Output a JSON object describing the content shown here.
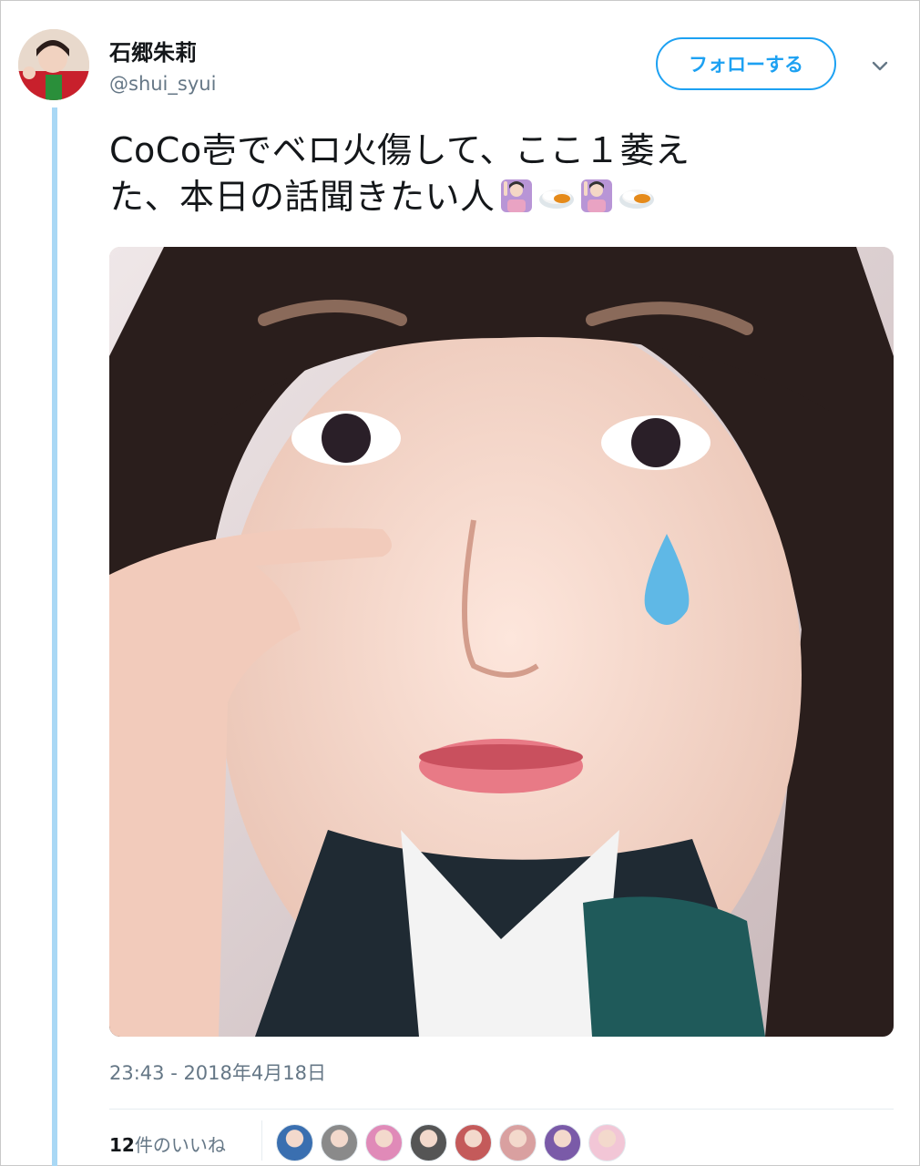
{
  "user": {
    "display_name": "石郷朱莉",
    "screen_name": "@shui_syui"
  },
  "follow_button_label": "フォローする",
  "tweet": {
    "line1": "CoCo壱でベロ火傷して、ここ１萎え",
    "line2": "た、本日の話聞きたい人",
    "emojis": [
      "raising-hand-woman-icon",
      "curry-rice-icon",
      "raising-hand-woman-icon",
      "curry-rice-icon"
    ]
  },
  "timestamp": "23:43 - 2018年4月18日",
  "likes": {
    "count": "12",
    "label": "件のいいね"
  },
  "likers": [
    {
      "color": "#3a6fb0"
    },
    {
      "color": "#8a8a8a"
    },
    {
      "color": "#e08ab8"
    },
    {
      "color": "#555555"
    },
    {
      "color": "#c45a5a"
    },
    {
      "color": "#d9a0a0"
    },
    {
      "color": "#7a5aa8"
    },
    {
      "color": "#f2c6d6"
    }
  ],
  "colors": {
    "accent": "#1da1f2",
    "thread_line": "#a9d8f5",
    "muted_text": "#657786"
  }
}
